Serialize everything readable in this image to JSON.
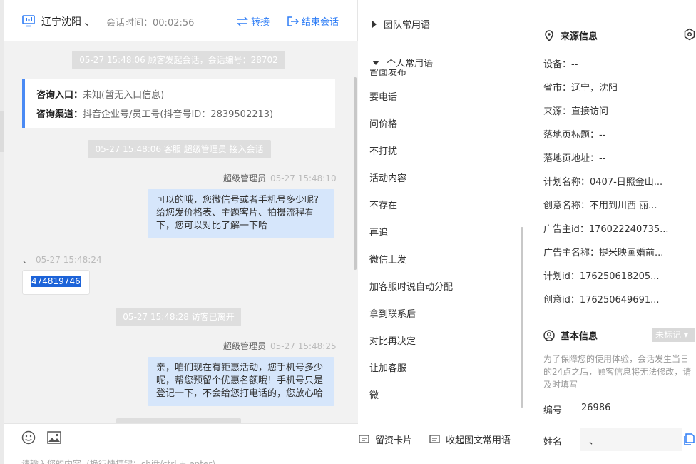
{
  "header": {
    "visitor_name": "辽宁沈阳 、",
    "session_time_label": "会话时间：",
    "session_time": "00:02:56",
    "transfer_label": "转接",
    "end_label": "结束会话"
  },
  "messages": {
    "sys_start": "05-27 15:48:06 顾客发起会话，会话编号：28702",
    "info_entry_label": "咨询入口：",
    "info_entry_value": "未知(暂无入口信息)",
    "info_channel_label": "咨询渠道：",
    "info_channel_value": "抖音企业号/员工号(抖音号ID：2839502213)",
    "sys_join": "05-27 15:48:06 客服 超级管理员 接入会话",
    "msg1_sender": "超级管理员",
    "msg1_time": "05-27 15:48:10",
    "msg1_text": "可以的哦，您微信号或者手机号多少呢? 给您发价格表、主题客片、拍摄流程看下，您可以对比了解一下哈",
    "msg2_sender": "、",
    "msg2_time": "05-27 15:48:24",
    "msg2_text": "474819746",
    "sys_leave": "05-27 15:48:28 访客已离开",
    "msg3_sender": "超级管理员",
    "msg3_time": "05-27 15:48:25",
    "msg3_text": "亲，咱们现在有钜惠活动，您手机号多少呢，帮您预留个优惠名额哦！手机号只是登记一下，不会给您打电话的，您放心哈"
  },
  "input": {
    "placeholder": "请输入您的内容（换行快捷键：shift/ctrl + enter）"
  },
  "phrases": {
    "team_title": "团队常用语",
    "personal_title": "个人常用语",
    "cut_item": "留面发布",
    "items": [
      "要电话",
      "问价格",
      "不打扰",
      "活动内容",
      "不存在",
      "再追",
      "微信上发",
      "加客服时说自动分配",
      "拿到联系后",
      "对比再决定",
      "让加客服",
      "微"
    ],
    "footer_card": "留资卡片",
    "footer_collapse": "收起图文常用语"
  },
  "source": {
    "title": "来源信息",
    "device": "设备：--",
    "city": "省市：辽宁，沈阳",
    "from": "来源：直接访问",
    "landing_title": "落地页标题：--",
    "landing_url": "落地页地址：--",
    "plan_name": "计划名称：0407-日照金山...",
    "creative_name": "创意名称：不用到川西 丽...",
    "advertiser_id": "广告主id：176022240735...",
    "advertiser_name": "广告主名称：提米映画婚前...",
    "plan_id": "计划id：176250618205...",
    "creative_id": "创意id：176250649691..."
  },
  "basic": {
    "title": "基本信息",
    "tag_label": "未标记",
    "notice": "为了保障您的使用体验，会话发生当日的24点之后，顾客信息将无法修改，请及时填写",
    "id_label": "编号",
    "id_value": "26986",
    "name_label": "姓名",
    "name_value": "、"
  },
  "colors": {
    "accent": "#2e7df6",
    "bubble_agent": "#d6e6fb",
    "system_msg": "#dedede"
  }
}
